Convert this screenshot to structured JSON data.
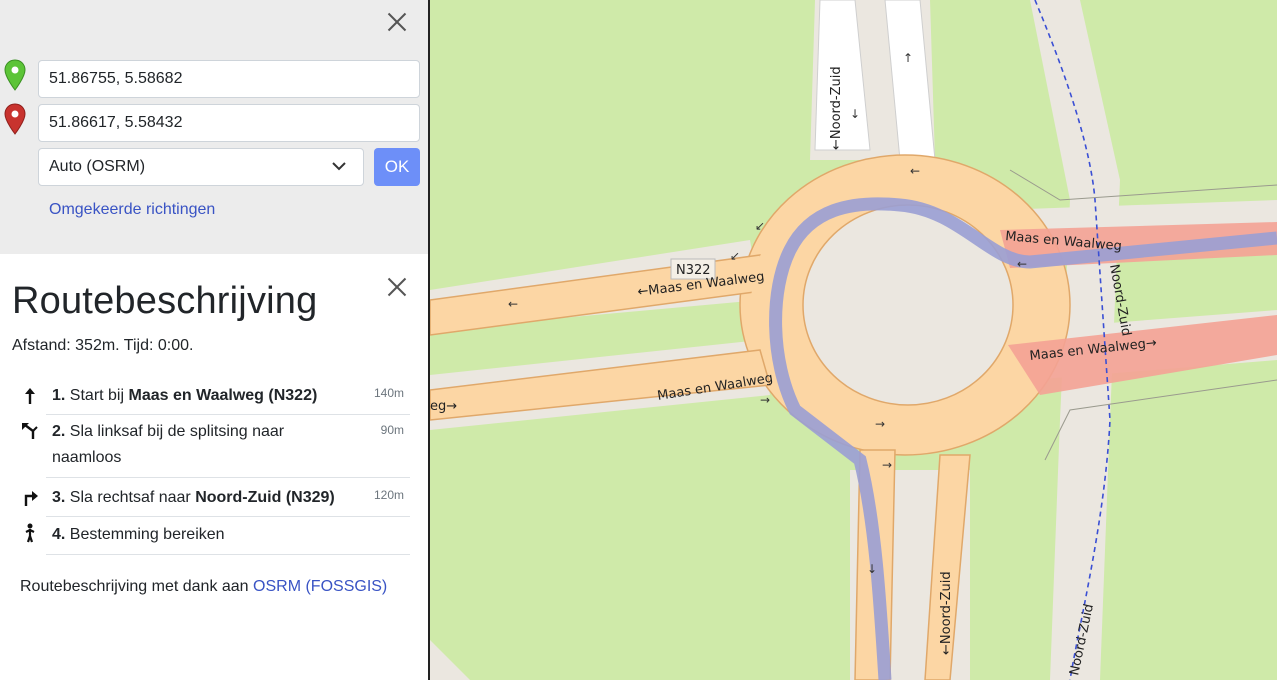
{
  "search": {
    "from_value": "51.86755, 5.58682",
    "to_value": "51.86617, 5.58432",
    "mode_selected": "Auto (OSRM)",
    "ok_label": "OK",
    "reverse_label": "Omgekeerde richtingen"
  },
  "directions": {
    "title": "Routebeschrijving",
    "summary": "Afstand: 352m. Tijd: 0:00.",
    "steps": [
      {
        "num": "1.",
        "pre": "Start bij ",
        "bold": "Maas en Waalweg (N322)",
        "dist": "140m",
        "icon": "straight-arrow-icon"
      },
      {
        "num": "2.",
        "pre": "Sla linksaf bij de splitsing naar naamloos",
        "bold": "",
        "dist": "90m",
        "icon": "fork-left-icon"
      },
      {
        "num": "3.",
        "pre": "Sla rechtsaf naar ",
        "bold": "Noord-Zuid (N329)",
        "dist": "120m",
        "icon": "turn-right-icon"
      },
      {
        "num": "4.",
        "pre": "Bestemming bereiken",
        "bold": "",
        "dist": "",
        "icon": "destination-person-icon"
      }
    ],
    "credit_prefix": "Routebeschrijving met dank aan ",
    "credit_link": "OSRM (FOSSGIS)"
  },
  "map": {
    "labels": {
      "n322": "N322",
      "maas_nw": "←Maas en Waalweg",
      "maas_ne": "Maas en Waalweg",
      "maas_e2": "Maas en Waalweg→",
      "maas_sw": "Maas en Waalweg",
      "maas_w_cut": "eg→",
      "noord_zuid_n": "←Noord-Zuid",
      "noord_zuid_s": "←Noord-Zuid",
      "noord_zuid_path": "Noord-Zuid",
      "noord_zuid_path2": "Noord-Zuid"
    },
    "colors": {
      "grass": "#cfeaa9",
      "road": "#fcd6a4",
      "road_edge": "#e0a86a",
      "route": "#9a9ed4",
      "highlight": "#f4a295",
      "path": "#3a4fd4"
    }
  }
}
